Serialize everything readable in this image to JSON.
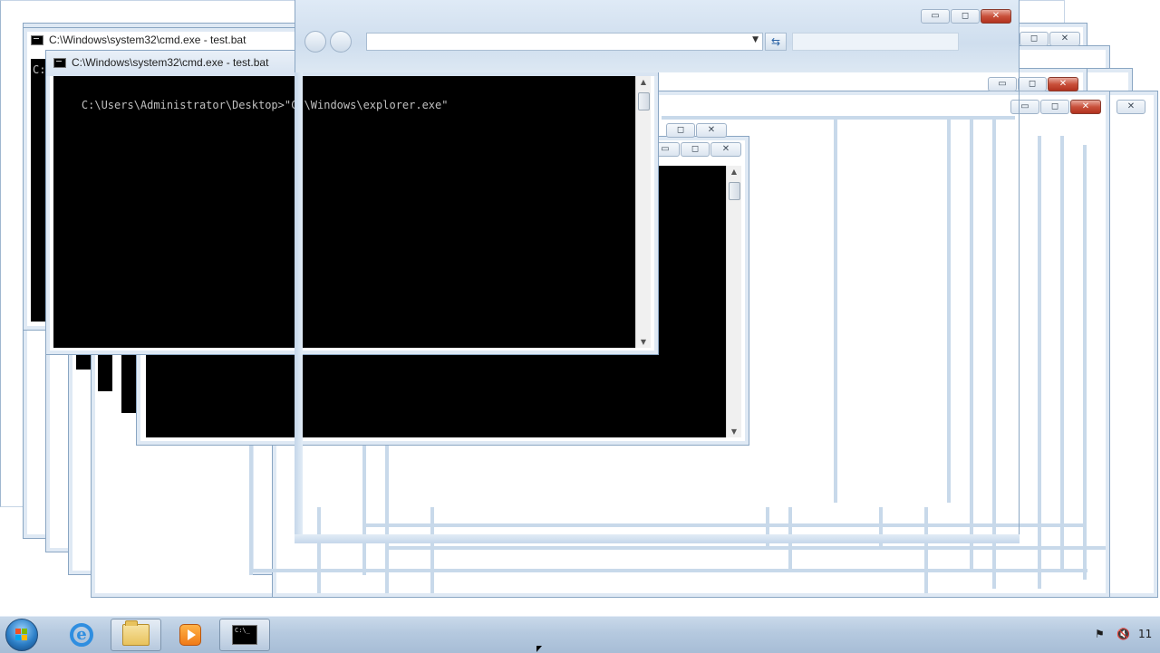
{
  "windows": {
    "cmd_back_title": "C:\\Windows\\system32\\cmd.exe - test.bat",
    "cmd_back_prompt": "C:",
    "cmd_front_title": "C:\\Windows\\system32\\cmd.exe - test.bat",
    "cmd_front_text": "C:\\Users\\Administrator\\Desktop>\"C:\\Windows\\explorer.exe\""
  },
  "caption_buttons": {
    "minimize": "▭",
    "maximize": "◻",
    "close": "✕"
  },
  "taskbar": {
    "pinned": [
      "start-orb",
      "internet-explorer-icon",
      "windows-explorer-icon",
      "media-player-icon",
      "command-prompt-icon"
    ],
    "cmd_icon_text": "C:\\_",
    "clock_fragment": "11"
  },
  "colors": {
    "taskbar": "#b5c9df",
    "console_bg": "#000000",
    "close_red": "#c9513b"
  }
}
